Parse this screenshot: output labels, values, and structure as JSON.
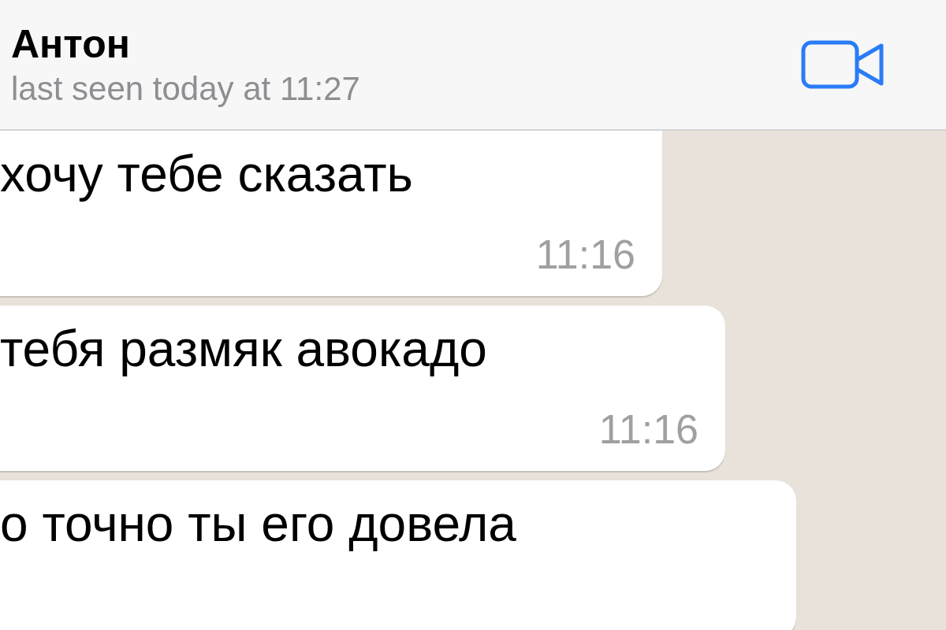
{
  "header": {
    "title": "Антон",
    "subtitle": "last seen today at 11:27"
  },
  "messages": [
    {
      "text": "хочу тебе сказать",
      "time": "11:16"
    },
    {
      "text": "тебя размяк авокадо",
      "time": "11:16"
    },
    {
      "text": "о точно ты его довела"
    }
  ]
}
